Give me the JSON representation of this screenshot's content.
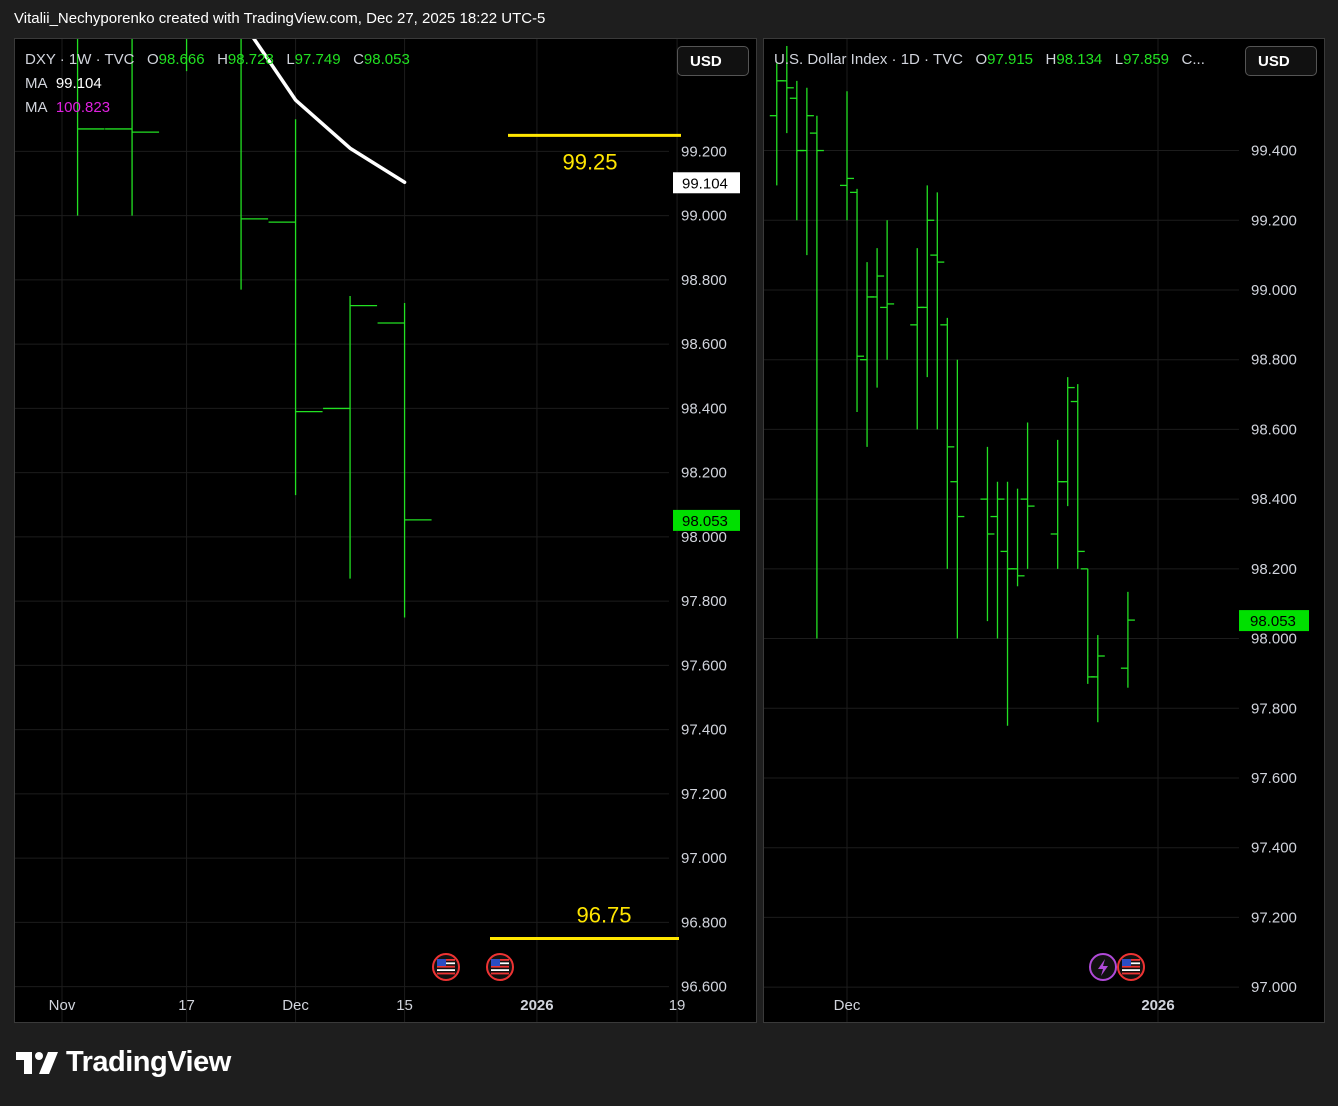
{
  "caption": "Vitalii_Nechyporenko created with TradingView.com, Dec 27, 2025 18:22 UTC-5",
  "brand": "TradingView",
  "colors": {
    "bar": "#22e022",
    "ma1": "#ffffff",
    "ma2": "#e020e0",
    "level": "#ffe600",
    "grid": "#1c1c1c",
    "background": "#000000"
  },
  "left_chart": {
    "symbol": "DXY · 1W · TVC",
    "ohlc": {
      "o_label": "O",
      "o": "98.666",
      "h_label": "H",
      "h": "98.728",
      "l_label": "L",
      "l": "97.749",
      "c_label": "C",
      "c": "98.053"
    },
    "ma1": {
      "label": "MA",
      "value": "99.104"
    },
    "ma2": {
      "label": "MA",
      "value": "100.823"
    },
    "currency_button": "USD",
    "last_price_tag": "98.053",
    "ma_tag": "99.104",
    "levels": [
      {
        "value": 99.25,
        "label": "99.25"
      },
      {
        "value": 96.75,
        "label": "96.75"
      }
    ],
    "event_icons": [
      "us-flag-icon",
      "us-flag-icon"
    ]
  },
  "right_chart": {
    "symbol": "U.S. Dollar Index · 1D · TVC",
    "ohlc": {
      "o_label": "O",
      "o": "97.915",
      "h_label": "H",
      "h": "98.134",
      "l_label": "L",
      "l": "97.859",
      "c_label": "C..."
    },
    "currency_button": "USD",
    "last_price_tag": "98.053",
    "event_icons": [
      "lightning-icon",
      "us-flag-icon"
    ]
  },
  "chart_data": [
    {
      "type": "ohlc",
      "title": "DXY · 1W · TVC",
      "ylim": [
        96.49,
        99.55
      ],
      "y_ticks": [
        96.6,
        96.8,
        97.0,
        97.2,
        97.4,
        97.6,
        97.8,
        98.0,
        98.2,
        98.4,
        98.6,
        98.8,
        99.0,
        99.2
      ],
      "y_tick_labels": [
        "96.600",
        "96.800",
        "97.000",
        "97.200",
        "97.400",
        "97.600",
        "97.800",
        "98.000",
        "98.200",
        "98.400",
        "98.600",
        "98.800",
        "99.000",
        "99.200"
      ],
      "x_tick_labels": [
        {
          "label": "Nov",
          "date": "2025-11-01"
        },
        {
          "label": "17",
          "date": "2025-11-17"
        },
        {
          "label": "Dec",
          "date": "2025-12-01"
        },
        {
          "label": "15",
          "date": "2025-12-15"
        },
        {
          "label": "2026",
          "date": "2026-01-01"
        },
        {
          "label": "19",
          "date": "2026-01-19"
        }
      ],
      "bars": [
        {
          "date": "2025-10-27",
          "o": 99.7,
          "h": 99.9,
          "l": 99.65,
          "c": 99.85
        },
        {
          "date": "2025-11-03",
          "o": 99.85,
          "h": 100.2,
          "l": 99.0,
          "c": 99.27
        },
        {
          "date": "2025-11-10",
          "o": 99.27,
          "h": 99.7,
          "l": 99.0,
          "c": 99.26
        },
        {
          "date": "2025-11-17",
          "o": 99.6,
          "h": 100.4,
          "l": 99.45,
          "c": 100.1
        },
        {
          "date": "2025-11-24",
          "o": 100.15,
          "h": 100.2,
          "l": 98.77,
          "c": 98.99
        },
        {
          "date": "2025-12-01",
          "o": 98.98,
          "h": 99.3,
          "l": 98.13,
          "c": 98.39
        },
        {
          "date": "2025-12-08",
          "o": 98.4,
          "h": 98.75,
          "l": 97.87,
          "c": 98.72
        },
        {
          "date": "2025-12-15",
          "o": 98.666,
          "h": 98.728,
          "l": 97.749,
          "c": 98.053
        }
      ],
      "ma_series": [
        {
          "date": "2025-11-24",
          "value": 99.61
        },
        {
          "date": "2025-12-01",
          "value": 99.36
        },
        {
          "date": "2025-12-08",
          "value": 99.21
        },
        {
          "date": "2025-12-15",
          "value": 99.104
        }
      ],
      "levels": [
        99.25,
        96.75
      ]
    },
    {
      "type": "ohlc",
      "title": "U.S. Dollar Index · 1D · TVC",
      "ylim": [
        96.9,
        99.72
      ],
      "y_ticks": [
        97.0,
        97.2,
        97.4,
        97.6,
        97.8,
        98.0,
        98.2,
        98.4,
        98.6,
        98.8,
        99.0,
        99.2,
        99.4
      ],
      "y_tick_labels": [
        "97.000",
        "97.200",
        "97.400",
        "97.600",
        "97.800",
        "98.000",
        "98.200",
        "98.400",
        "98.600",
        "98.800",
        "99.000",
        "99.200",
        "99.400"
      ],
      "x_tick_labels": [
        {
          "label": "Dec",
          "date": "2025-12-01"
        },
        {
          "label": "2026",
          "date": "2026-01-01"
        }
      ],
      "bars": [
        {
          "date": "2025-11-20",
          "o": 99.75,
          "h": 99.85,
          "l": 99.55,
          "c": 99.7
        },
        {
          "date": "2025-11-21",
          "o": 99.7,
          "h": 99.75,
          "l": 99.47,
          "c": 99.5
        },
        {
          "date": "2025-11-24",
          "o": 99.5,
          "h": 99.65,
          "l": 99.3,
          "c": 99.6
        },
        {
          "date": "2025-11-25",
          "o": 99.6,
          "h": 99.7,
          "l": 99.45,
          "c": 99.58
        },
        {
          "date": "2025-11-26",
          "o": 99.55,
          "h": 99.6,
          "l": 99.2,
          "c": 99.4
        },
        {
          "date": "2025-11-27",
          "o": 99.4,
          "h": 99.58,
          "l": 99.1,
          "c": 99.5
        },
        {
          "date": "2025-11-28",
          "o": 99.45,
          "h": 99.5,
          "l": 98.0,
          "c": 99.4
        },
        {
          "date": "2025-12-01",
          "o": 99.3,
          "h": 99.57,
          "l": 99.2,
          "c": 99.32
        },
        {
          "date": "2025-12-02",
          "o": 99.28,
          "h": 99.29,
          "l": 98.65,
          "c": 98.81
        },
        {
          "date": "2025-12-03",
          "o": 98.8,
          "h": 99.08,
          "l": 98.55,
          "c": 98.98
        },
        {
          "date": "2025-12-04",
          "o": 98.98,
          "h": 99.12,
          "l": 98.72,
          "c": 99.04
        },
        {
          "date": "2025-12-05",
          "o": 98.95,
          "h": 99.2,
          "l": 98.8,
          "c": 98.96
        },
        {
          "date": "2025-12-08",
          "o": 98.9,
          "h": 99.12,
          "l": 98.6,
          "c": 98.95
        },
        {
          "date": "2025-12-09",
          "o": 98.95,
          "h": 99.3,
          "l": 98.75,
          "c": 99.2
        },
        {
          "date": "2025-12-10",
          "o": 99.1,
          "h": 99.28,
          "l": 98.6,
          "c": 99.08
        },
        {
          "date": "2025-12-11",
          "o": 98.9,
          "h": 98.92,
          "l": 98.2,
          "c": 98.55
        },
        {
          "date": "2025-12-12",
          "o": 98.45,
          "h": 98.8,
          "l": 98.0,
          "c": 98.35
        },
        {
          "date": "2025-12-15",
          "o": 98.4,
          "h": 98.55,
          "l": 98.05,
          "c": 98.3
        },
        {
          "date": "2025-12-16",
          "o": 98.35,
          "h": 98.45,
          "l": 98.0,
          "c": 98.4
        },
        {
          "date": "2025-12-17",
          "o": 98.25,
          "h": 98.45,
          "l": 97.75,
          "c": 98.2
        },
        {
          "date": "2025-12-18",
          "o": 98.2,
          "h": 98.43,
          "l": 98.15,
          "c": 98.18
        },
        {
          "date": "2025-12-19",
          "o": 98.4,
          "h": 98.62,
          "l": 98.2,
          "c": 98.38
        },
        {
          "date": "2025-12-22",
          "o": 98.3,
          "h": 98.57,
          "l": 98.2,
          "c": 98.45
        },
        {
          "date": "2025-12-23",
          "o": 98.45,
          "h": 98.75,
          "l": 98.38,
          "c": 98.72
        },
        {
          "date": "2025-12-24",
          "o": 98.68,
          "h": 98.73,
          "l": 98.2,
          "c": 98.25
        },
        {
          "date": "2025-12-25",
          "o": 98.2,
          "h": 98.2,
          "l": 97.87,
          "c": 97.89
        },
        {
          "date": "2025-12-26",
          "o": 97.89,
          "h": 98.01,
          "l": 97.76,
          "c": 97.95
        },
        {
          "date": "2025-12-29",
          "o": 97.915,
          "h": 98.134,
          "l": 97.859,
          "c": 98.053
        }
      ]
    }
  ]
}
